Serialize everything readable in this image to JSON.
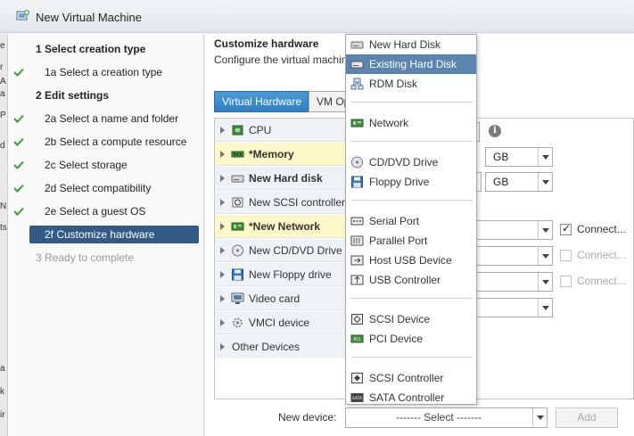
{
  "window": {
    "title": "New Virtual Machine"
  },
  "edge_strip": [
    "e",
    "r",
    "A",
    "a",
    "P",
    "d",
    "N",
    "ts",
    "a",
    "k",
    "ir"
  ],
  "steps": [
    {
      "label": "1  Select creation type",
      "kind": "header",
      "done": false
    },
    {
      "label": "1a  Select a creation type",
      "kind": "sub",
      "done": true
    },
    {
      "label": "2  Edit settings",
      "kind": "header",
      "done": false
    },
    {
      "label": "2a  Select a name and folder",
      "kind": "sub",
      "done": true
    },
    {
      "label": "2b  Select a compute resource",
      "kind": "sub",
      "done": true
    },
    {
      "label": "2c  Select storage",
      "kind": "sub",
      "done": true
    },
    {
      "label": "2d  Select compatibility",
      "kind": "sub",
      "done": true
    },
    {
      "label": "2e  Select a guest OS",
      "kind": "sub",
      "done": true
    },
    {
      "label": "2f  Customize hardware",
      "kind": "active",
      "done": false
    },
    {
      "label": "3  Ready to complete",
      "kind": "disabled",
      "done": false
    }
  ],
  "main": {
    "heading": "Customize hardware",
    "subheading": "Configure the virtual machine hardware",
    "tabs": [
      "Virtual Hardware",
      "VM Options"
    ]
  },
  "hardware": [
    {
      "label": "CPU",
      "changed": false
    },
    {
      "label": "*Memory",
      "changed": true
    },
    {
      "label": "New Hard disk",
      "changed": false,
      "bold": true
    },
    {
      "label": "New SCSI controller",
      "changed": false
    },
    {
      "label": "*New Network",
      "changed": true
    },
    {
      "label": "New CD/DVD Drive",
      "changed": false
    },
    {
      "label": "New Floppy drive",
      "changed": false
    },
    {
      "label": "Video card",
      "changed": false
    },
    {
      "label": "VMCI device",
      "changed": false
    },
    {
      "label": "Other Devices",
      "changed": false
    }
  ],
  "controls": {
    "memory_unit": "GB",
    "disk_unit": "GB",
    "connect_label": "Connect...",
    "info_symbol": "i"
  },
  "new_device": {
    "label": "New device:",
    "select_value": "------- Select -------",
    "add_label": "Add"
  },
  "menu": {
    "groups": [
      [
        "New Hard Disk",
        "Existing Hard Disk",
        "RDM Disk"
      ],
      [
        "Network"
      ],
      [
        "CD/DVD Drive",
        "Floppy Drive"
      ],
      [
        "Serial Port",
        "Parallel Port",
        "Host USB Device",
        "USB Controller"
      ],
      [
        "SCSI Device",
        "PCI Device"
      ],
      [
        "SCSI Controller",
        "SATA Controller"
      ]
    ],
    "highlighted": "Existing Hard Disk"
  },
  "colors": {
    "accent": "#315a87",
    "tab_active": "#3a8bcc",
    "changed_row": "#fdf8c8",
    "check": "#3a9a3a",
    "menu_highlight": "#5b84b1"
  }
}
